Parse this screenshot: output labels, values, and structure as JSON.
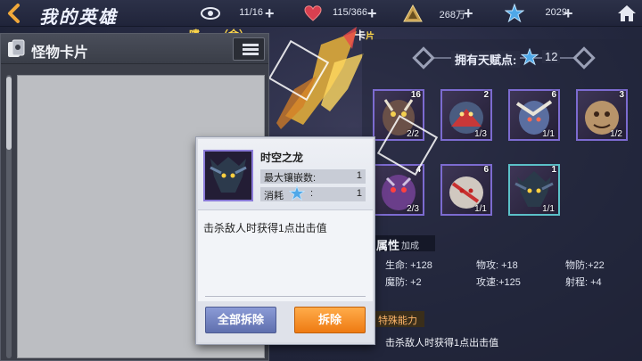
{
  "header": {
    "title": "我的英雄",
    "resources": [
      {
        "icon": "eye-icon",
        "value": "11/16"
      },
      {
        "icon": "heart-icon",
        "value": "115/366"
      },
      {
        "icon": "triangle-icon",
        "value": "268万"
      },
      {
        "icon": "star-icon",
        "value": "2029"
      }
    ],
    "plus": "+"
  },
  "background": {
    "hero_name_fragment": "嘍",
    "hero_tier": "（金）",
    "card_tag": "卡",
    "card_tag_sub": "片"
  },
  "monster_panel": {
    "title": "怪物卡片"
  },
  "talent": {
    "label": "拥有天赋点:",
    "value": "12"
  },
  "cards": [
    {
      "level": "16",
      "count": "2/2"
    },
    {
      "level": "2",
      "count": "1/3"
    },
    {
      "level": "6",
      "count": "1/1"
    },
    {
      "level": "3",
      "count": "1/2"
    },
    {
      "level": "4",
      "count": "2/3"
    },
    {
      "level": "6",
      "count": "1/1"
    },
    {
      "level": "1",
      "count": "1/1"
    }
  ],
  "attributes": {
    "title": "属性",
    "title_sub": "加成",
    "stats": [
      {
        "label": "生命:",
        "value": "+128"
      },
      {
        "label": "物攻:",
        "value": "+18"
      },
      {
        "label": "物防:",
        "value": "+22"
      },
      {
        "label": "魔防:",
        "value": "+2"
      },
      {
        "label": "攻速:",
        "value": "+125"
      },
      {
        "label": "射程:",
        "value": "+4"
      }
    ]
  },
  "special": {
    "title": "特殊能力",
    "desc": "击杀敌人时获得1点出击值"
  },
  "popup": {
    "name": "时空之龙",
    "max_slots_label": "最大镶嵌数:",
    "max_slots_value": "1",
    "cost_label": "消耗",
    "cost_colon": ":",
    "cost_value": "1",
    "desc": "击杀敌人时获得1点出击值",
    "btn_remove_all": "全部拆除",
    "btn_remove": "拆除"
  },
  "colors": {
    "accent_orange": "#ee7a12",
    "accent_blue": "#5f6fae",
    "card_border": "#7c6bd0"
  }
}
